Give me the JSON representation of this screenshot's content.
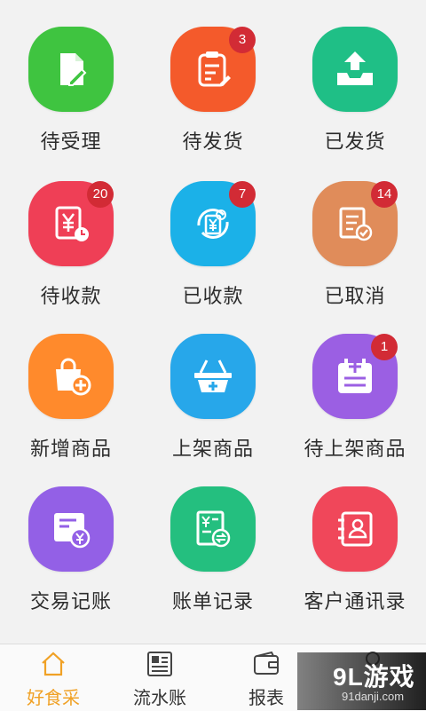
{
  "grid": [
    {
      "label": "待受理",
      "icon": "form-edit-icon",
      "color": "#3fc440",
      "badge": null
    },
    {
      "label": "待发货",
      "icon": "clipboard-edit-icon",
      "color": "#f45a2b",
      "badge": "3"
    },
    {
      "label": "已发货",
      "icon": "upload-tray-icon",
      "color": "#1fbf86",
      "badge": null
    },
    {
      "label": "待收款",
      "icon": "yuan-clock-icon",
      "color": "#ef3f56",
      "badge": "20"
    },
    {
      "label": "已收款",
      "icon": "yuan-refresh-icon",
      "color": "#1bb1e8",
      "badge": "7"
    },
    {
      "label": "已取消",
      "icon": "document-check-icon",
      "color": "#e08c5a",
      "badge": "14"
    },
    {
      "label": "新增商品",
      "icon": "bag-plus-icon",
      "color": "#ff8a2c",
      "badge": null
    },
    {
      "label": "上架商品",
      "icon": "basket-plus-icon",
      "color": "#27a7ea",
      "badge": null
    },
    {
      "label": "待上架商品",
      "icon": "calendar-plus-icon",
      "color": "#9b5fe3",
      "badge": "1"
    },
    {
      "label": "交易记账",
      "icon": "ledger-yuan-icon",
      "color": "#9360e6",
      "badge": null
    },
    {
      "label": "账单记录",
      "icon": "bill-exchange-icon",
      "color": "#24bf7f",
      "badge": null
    },
    {
      "label": "客户通讯录",
      "icon": "contacts-icon",
      "color": "#f0475a",
      "badge": null
    }
  ],
  "tabs": [
    {
      "label": "好食采",
      "icon": "home-icon",
      "active": true
    },
    {
      "label": "流水账",
      "icon": "newspaper-icon",
      "active": false
    },
    {
      "label": "报表",
      "icon": "wallet-icon",
      "active": false
    },
    {
      "label": "",
      "icon": "user-icon",
      "active": false
    }
  ],
  "watermark": {
    "main": "9L游戏",
    "sub": "91danji.com"
  }
}
